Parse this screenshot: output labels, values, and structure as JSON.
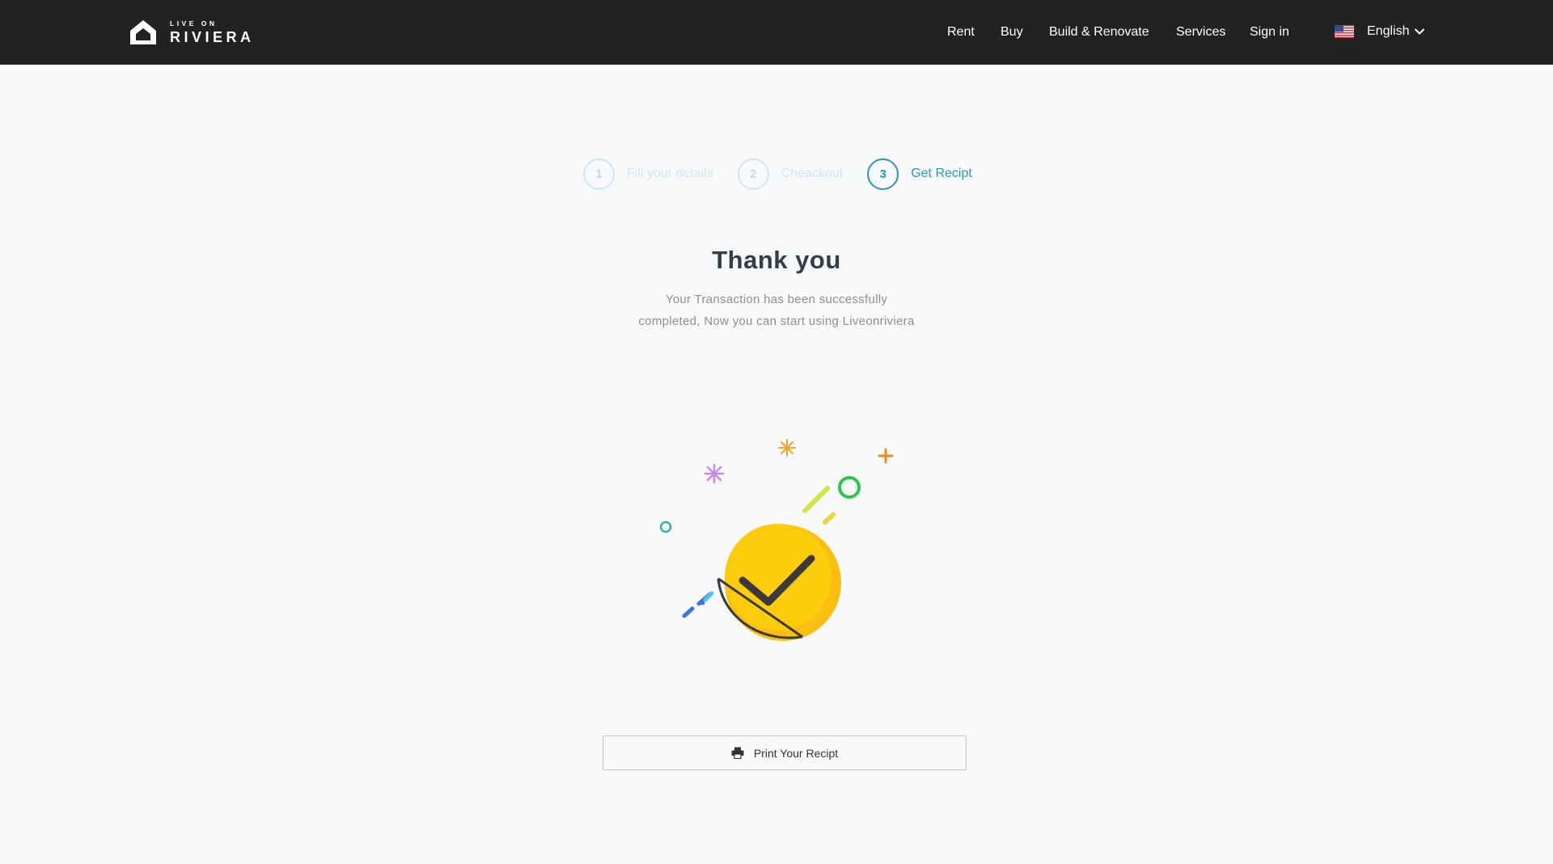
{
  "brand": {
    "tagline": "LIVE ON",
    "name": "RIVIERA"
  },
  "nav": {
    "items": [
      "Rent",
      "Buy",
      "Build & Renovate",
      "Services",
      "Sign in"
    ],
    "language": "English"
  },
  "stepper": {
    "steps": [
      {
        "number": "1",
        "label": "Fill your details",
        "active": false
      },
      {
        "number": "2",
        "label": "Cheackout",
        "active": false
      },
      {
        "number": "3",
        "label": "Get Recipt",
        "active": true
      }
    ]
  },
  "main": {
    "title": "Thank you",
    "message_line1": "Your Transaction has been successfully",
    "message_line2": "completed, Now you can start using Liveonriviera",
    "print_button": "Print Your Recipt"
  },
  "colors": {
    "header_bg": "#222222",
    "page_bg": "#f8f9fb",
    "accent": "#2f96b8",
    "success_yellow": "#fccc0d"
  },
  "icons": {
    "logo": "house-icon",
    "flag": "us-flag-icon",
    "chevron": "chevron-down-icon",
    "print": "printer-icon",
    "illustration": "success-check-icon"
  }
}
